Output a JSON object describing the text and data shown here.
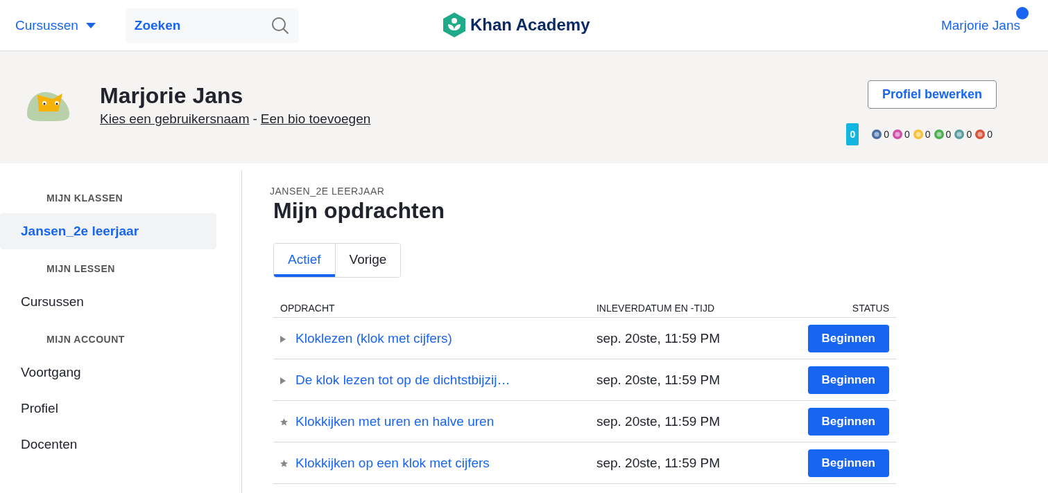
{
  "header": {
    "courses_menu": "Cursussen",
    "search": {
      "placeholder": "Zoeken"
    },
    "logo": "Khan Academy",
    "user": "Marjorie Jans",
    "notification": true
  },
  "profile": {
    "name": "Marjorie Jans",
    "links": [
      "Kies een gebruikersnaam",
      "Een bio toevoegen"
    ],
    "separator": "-",
    "edit_button": "Profiel bewerken",
    "energy_points": "0",
    "badges": [
      {
        "color": "#4a6fa5",
        "count": "0"
      },
      {
        "color": "#d04fa8",
        "count": "0"
      },
      {
        "color": "#f5c23a",
        "count": "0"
      },
      {
        "color": "#4caf50",
        "count": "0"
      },
      {
        "color": "#5c9ea0",
        "count": "0"
      },
      {
        "color": "#d9533a",
        "count": "0"
      }
    ]
  },
  "sidebar": {
    "sections": [
      {
        "heading": "MIJN KLASSEN",
        "items": [
          {
            "label": "Jansen_2e leerjaar",
            "selected": true
          }
        ]
      },
      {
        "heading": "MIJN LESSEN",
        "items": [
          {
            "label": "Cursussen",
            "selected": false
          }
        ]
      },
      {
        "heading": "MIJN ACCOUNT",
        "items": [
          {
            "label": "Voortgang",
            "selected": false
          },
          {
            "label": "Profiel",
            "selected": false
          },
          {
            "label": "Docenten",
            "selected": false
          }
        ]
      }
    ]
  },
  "main": {
    "class_label": "JANSEN_2E LEERJAAR",
    "title": "Mijn opdrachten",
    "tabs": [
      {
        "label": "Actief",
        "selected": true
      },
      {
        "label": "Vorige",
        "selected": false
      }
    ],
    "table": {
      "columns": [
        "OPDRACHT",
        "INLEVERDATUM EN -TIJD",
        "STATUS"
      ],
      "rows": [
        {
          "kind": "triangle",
          "title": "Kloklezen (klok met cijfers)",
          "due": "sep. 20ste, 11:59 PM",
          "action": "Beginnen"
        },
        {
          "kind": "triangle",
          "title": "De klok lezen tot op de dichtstbijzij…",
          "due": "sep. 20ste, 11:59 PM",
          "action": "Beginnen"
        },
        {
          "kind": "star",
          "title": "Klokkijken met uren en halve uren",
          "due": "sep. 20ste, 11:59 PM",
          "action": "Beginnen"
        },
        {
          "kind": "star",
          "title": "Klokkijken op een klok met cijfers",
          "due": "sep. 20ste, 11:59 PM",
          "action": "Beginnen"
        }
      ]
    }
  }
}
